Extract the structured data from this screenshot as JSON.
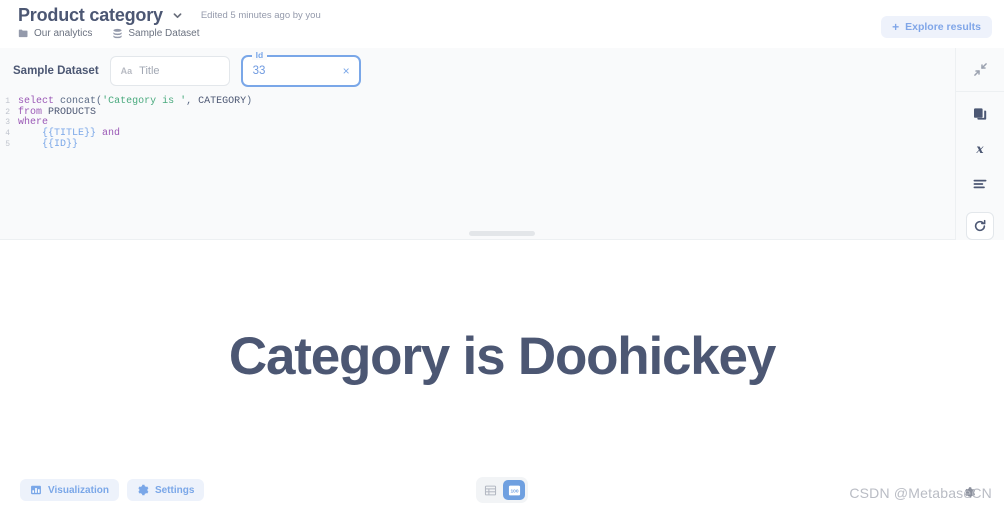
{
  "header": {
    "title": "Product category",
    "chevron_icon": "chevron-down-icon",
    "edited_info": "Edited 5 minutes ago by you",
    "breadcrumbs": [
      {
        "label": "Our analytics",
        "icon": "folder-icon"
      },
      {
        "label": "Sample Dataset",
        "icon": "database-icon"
      }
    ],
    "explore_button": {
      "label": "Explore results",
      "icon": "plus-icon",
      "bg": "#eef2fb",
      "fg": "#80a6e8"
    }
  },
  "query": {
    "dataset_label": "Sample Dataset",
    "params": [
      {
        "name": "title",
        "label": "Title",
        "placeholder": "Title",
        "type_icon": "Aa",
        "value": "",
        "focused": false
      },
      {
        "name": "id",
        "label": "Id",
        "value": "33",
        "clear_icon": "×",
        "focused": true,
        "accent": "#7aa7e8"
      }
    ],
    "editor": {
      "lines": [
        {
          "num": "1",
          "tokens": [
            {
              "t": "select",
              "c": "k-kw"
            },
            {
              "t": " ",
              "c": "k-op"
            },
            {
              "t": "concat",
              "c": "k-fn"
            },
            {
              "t": "(",
              "c": "k-op"
            },
            {
              "t": "'Category is '",
              "c": "k-str"
            },
            {
              "t": ", ",
              "c": "k-op"
            },
            {
              "t": "CATEGORY",
              "c": "k-id"
            },
            {
              "t": ")",
              "c": "k-op"
            }
          ]
        },
        {
          "num": "2",
          "tokens": [
            {
              "t": "from",
              "c": "k-kw"
            },
            {
              "t": " ",
              "c": "k-op"
            },
            {
              "t": "PRODUCTS",
              "c": "k-id"
            }
          ]
        },
        {
          "num": "3",
          "tokens": [
            {
              "t": "where",
              "c": "k-kw"
            }
          ]
        },
        {
          "num": "4",
          "tokens": [
            {
              "t": "    ",
              "c": "k-op"
            },
            {
              "t": "{{TITLE}}",
              "c": "k-var"
            },
            {
              "t": " ",
              "c": "k-op"
            },
            {
              "t": "and",
              "c": "k-kw"
            }
          ]
        },
        {
          "num": "5",
          "tokens": [
            {
              "t": "    ",
              "c": "k-op"
            },
            {
              "t": "{{ID}}",
              "c": "k-var"
            }
          ]
        }
      ]
    },
    "sidebar": {
      "collapse_icon": "collapse-arrows-icon",
      "tools": [
        {
          "name": "data-reference-icon",
          "title": "Data Reference"
        },
        {
          "name": "variables-icon",
          "title": "Variables"
        },
        {
          "name": "format-query-icon",
          "title": "Format"
        }
      ],
      "run_button": {
        "name": "refresh-run-icon",
        "title": "Refresh"
      }
    },
    "drag_handle": "resize-handle"
  },
  "result": {
    "scalar_value": "Category is Doohickey",
    "color": "#4c5773"
  },
  "footer": {
    "buttons": [
      {
        "label": "Visualization",
        "icon": "chart-icon"
      },
      {
        "label": "Settings",
        "icon": "gear-icon"
      }
    ],
    "view_toggle": [
      {
        "name": "table-view-icon",
        "active": false
      },
      {
        "name": "scalar-view-icon",
        "active": true
      }
    ],
    "watermark": "CSDN @MetabaseCN"
  }
}
